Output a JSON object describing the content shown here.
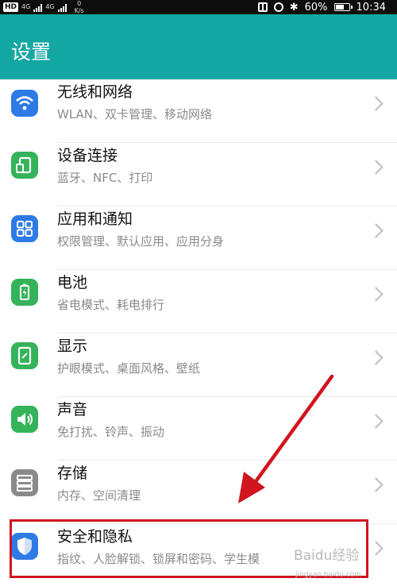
{
  "status_bar": {
    "carrier_badge": "HD",
    "net1": "4G",
    "net2": "4G",
    "speed_value": "0",
    "speed_unit": "K/s",
    "battery": "60%",
    "time": "10:34"
  },
  "header": {
    "title": "设置"
  },
  "settings": [
    {
      "title": "无线和网络",
      "subtitle": "WLAN、双卡管理、移动网络",
      "icon": "wifi-icon",
      "color": "#2f7be5"
    },
    {
      "title": "设备连接",
      "subtitle": "蓝牙、NFC、打印",
      "icon": "device-connection-icon",
      "color": "#34b35a"
    },
    {
      "title": "应用和通知",
      "subtitle": "权限管理、默认应用、应用分身",
      "icon": "apps-grid-icon",
      "color": "#2f7be5"
    },
    {
      "title": "电池",
      "subtitle": "省电模式、耗电排行",
      "icon": "battery-icon",
      "color": "#34b35a"
    },
    {
      "title": "显示",
      "subtitle": "护眼模式、桌面风格、壁纸",
      "icon": "display-icon",
      "color": "#34b35a"
    },
    {
      "title": "声音",
      "subtitle": "免打扰、铃声、振动",
      "icon": "speaker-icon",
      "color": "#34b35a"
    },
    {
      "title": "存储",
      "subtitle": "内存、空间清理",
      "icon": "storage-icon",
      "color": "#8a8a8a"
    },
    {
      "title": "安全和隐私",
      "subtitle": "指纹、人脸解锁、锁屏和密码、学生模",
      "icon": "shield-icon",
      "color": "#2f7be5"
    }
  ],
  "watermark": {
    "text": "Baidu经验",
    "url": "jingyan.baidu.com"
  },
  "colors": {
    "accent": "#13a7a4",
    "highlight": "#d0151f"
  }
}
